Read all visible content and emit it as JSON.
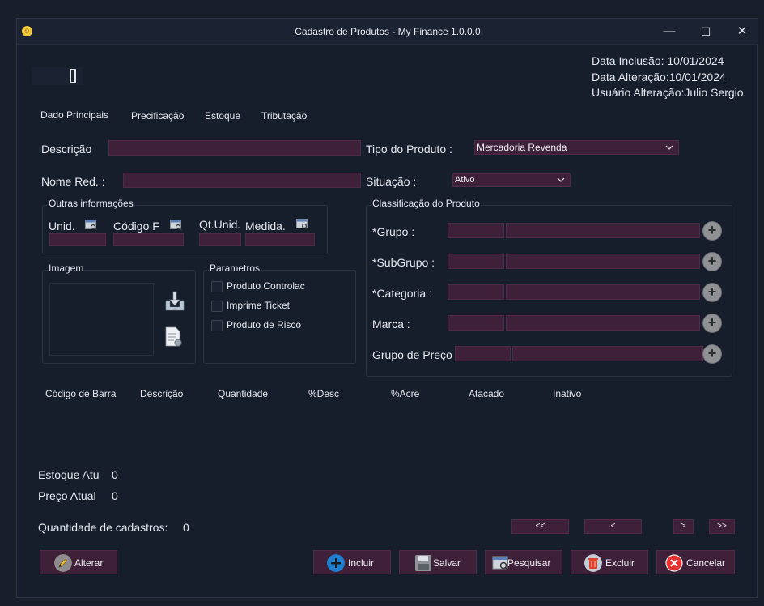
{
  "window": {
    "title": "Cadastro de Produtos - My Finance 1.0.0.0",
    "icon": "smiley-icon",
    "minimize_label": "—",
    "maximize_label": "☐",
    "close_label": "✕"
  },
  "info": {
    "data_inclusao": "Data Inclusão: 10/01/2024",
    "data_alteracao": "Data Alteração:10/01/2024",
    "usuario_alteracao": "Usuário Alteração:Julio Sergio"
  },
  "tabs": [
    "Dado Principais",
    "Precificação",
    "Estoque",
    "Tributação"
  ],
  "main": {
    "descricao_label": "Descrição",
    "nome_red_label": "Nome Red. :",
    "tipo_produto_label": "Tipo do Produto :",
    "tipo_produto_value": "Mercadoria Revenda",
    "situacao_label": "Situação :",
    "situacao_value": "Ativo"
  },
  "outras": {
    "title": "Outras informações",
    "unid_label": "Unid.",
    "codigo_label": "Código F",
    "qt_unid_label": "Qt.Unid.",
    "medida_label": "Medida."
  },
  "classificacao": {
    "title": "Classificação do Produto",
    "rows": [
      "*Grupo :",
      "*SubGrupo :",
      "*Categoria :",
      "Marca :",
      "Grupo de Preço"
    ]
  },
  "imagem": {
    "title": "Imagem"
  },
  "parametros": {
    "title": "Parametros",
    "items": [
      "Produto Controlac",
      "Imprime Ticket",
      "Produto de Risco"
    ]
  },
  "table": {
    "columns": [
      "Código de Barra",
      "Descrição",
      "Quantidade",
      "%Desc",
      "%Acre",
      "Atacado",
      "Inativo"
    ]
  },
  "footer": {
    "estoque_label": "Estoque Atu",
    "estoque_value": "0",
    "preco_label": "Preço Atual",
    "preco_value": "0",
    "qtd_cadastros_label": "Quantidade de cadastros:",
    "qtd_cadastros_value": "0"
  },
  "nav": {
    "first": "<<",
    "prev": "<",
    "next": ">",
    "last": ">>"
  },
  "actions": {
    "alterar": "Alterar",
    "incluir": "Incluir",
    "salvar": "Salvar",
    "pesquisar": "Pesquisar",
    "excluir": "Excluir",
    "cancelar": "Cancelar"
  }
}
